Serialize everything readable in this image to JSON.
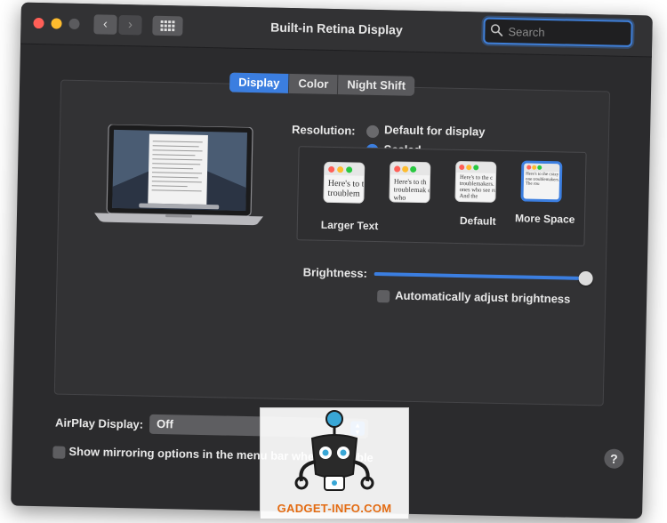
{
  "window": {
    "title": "Built-in Retina Display"
  },
  "toolbar": {
    "back_icon": "chevron-left-icon",
    "forward_icon": "chevron-right-icon",
    "grid_icon": "grid-icon"
  },
  "search": {
    "placeholder": "Search",
    "icon": "search-icon"
  },
  "tabs": [
    {
      "label": "Display",
      "active": true
    },
    {
      "label": "Color",
      "active": false
    },
    {
      "label": "Night Shift",
      "active": false
    }
  ],
  "resolution": {
    "label": "Resolution:",
    "options": [
      {
        "label": "Default for display",
        "checked": false
      },
      {
        "label": "Scaled",
        "checked": true
      }
    ],
    "scales": [
      {
        "label": "Larger Text",
        "preview": "Here's to the troublem",
        "selected": false
      },
      {
        "label": "",
        "preview": "Here's to th troublemak ones who",
        "selected": false
      },
      {
        "label": "Default",
        "preview": "Here's to the c troublemakers. ones who see rules. And the",
        "selected": false
      },
      {
        "label": "More Space",
        "preview": "Here's to the crazy one troublemakers. The rou",
        "selected": true
      }
    ]
  },
  "brightness": {
    "label": "Brightness:",
    "level": 1.0,
    "auto_label": "Automatically adjust brightness",
    "auto_checked": false
  },
  "airplay": {
    "label": "AirPlay Display:",
    "value": "Off"
  },
  "mirroring": {
    "label": "Show mirroring options in the menu bar when available",
    "checked": false
  },
  "watermark": {
    "text": "GADGET-INFO.COM"
  },
  "colors": {
    "accent": "#3b7ee0",
    "window_bg": "#2b2b2d",
    "watermark": "#e36b12"
  }
}
